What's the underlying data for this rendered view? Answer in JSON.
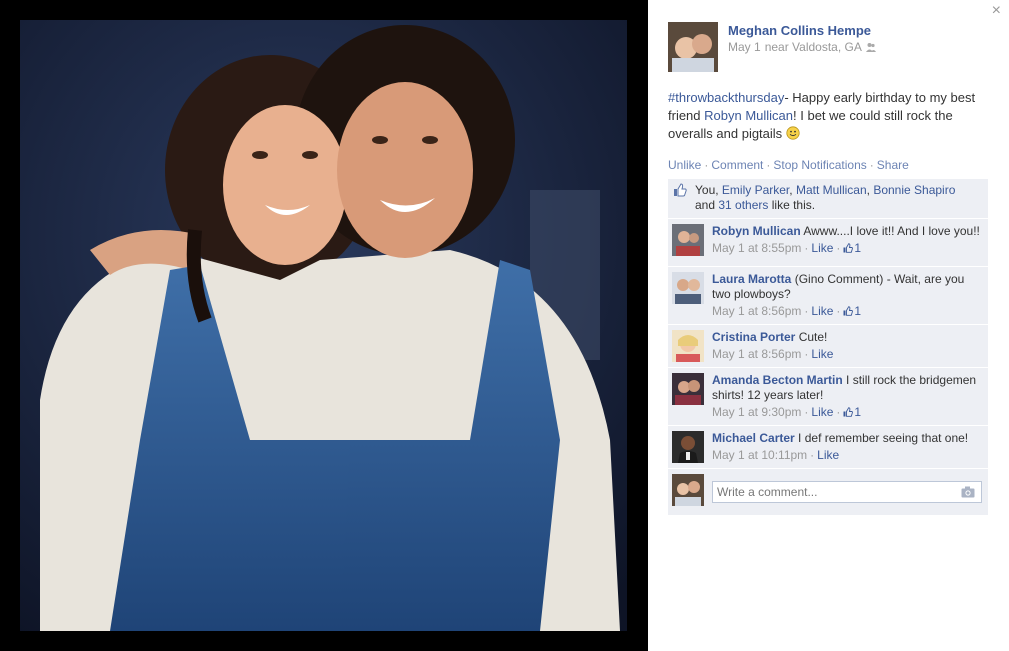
{
  "post": {
    "author": "Meghan Collins Hempe",
    "date": "May 1",
    "location": "near Valdosta, GA",
    "caption": {
      "hashtag": "#throwbackthursday",
      "part1": "- Happy early birthday to my best friend ",
      "mention": "Robyn Mullican",
      "part2": "! I bet we could still rock the overalls and pigtails "
    }
  },
  "actions": {
    "unlike": "Unlike",
    "comment": "Comment",
    "stop_notifications": "Stop Notifications",
    "share": "Share",
    "separator": "·"
  },
  "likes": {
    "you": "You, ",
    "names": [
      "Emily Parker",
      "Matt Mullican",
      "Bonnie Shapiro"
    ],
    "comma": ", ",
    "and": "and ",
    "others": "31 others",
    "suffix": " like this."
  },
  "comments": [
    {
      "name": "Robyn Mullican",
      "text": "Awww....I love it!! And I love you!!",
      "time": "May 1 at 8:55pm",
      "like_label": "Like",
      "likes": "1"
    },
    {
      "name": "Laura Marotta",
      "text": "(Gino Comment) - Wait, are you two plowboys?",
      "time": "May 1 at 8:56pm",
      "like_label": "Like",
      "likes": "1"
    },
    {
      "name": "Cristina Porter",
      "text": "Cute!",
      "time": "May 1 at 8:56pm",
      "like_label": "Like",
      "likes": null
    },
    {
      "name": "Amanda Becton Martin",
      "text": "I still rock the bridgemen shirts! 12 years later!",
      "time": "May 1 at 9:30pm",
      "like_label": "Like",
      "likes": "1"
    },
    {
      "name": "Michael Carter",
      "text": "I def remember seeing that one!",
      "time": "May 1 at 10:11pm",
      "like_label": "Like",
      "likes": null
    }
  ],
  "composer": {
    "placeholder": "Write a comment..."
  },
  "close_glyph": "×",
  "icons": [
    "close-icon",
    "people-icon",
    "smiley-icon",
    "thumbs-up-icon",
    "camera-icon"
  ],
  "colors": {
    "link": "#3b5998",
    "action": "#6d84b4",
    "ufi_bg": "#edeff4",
    "meta": "#999999"
  }
}
